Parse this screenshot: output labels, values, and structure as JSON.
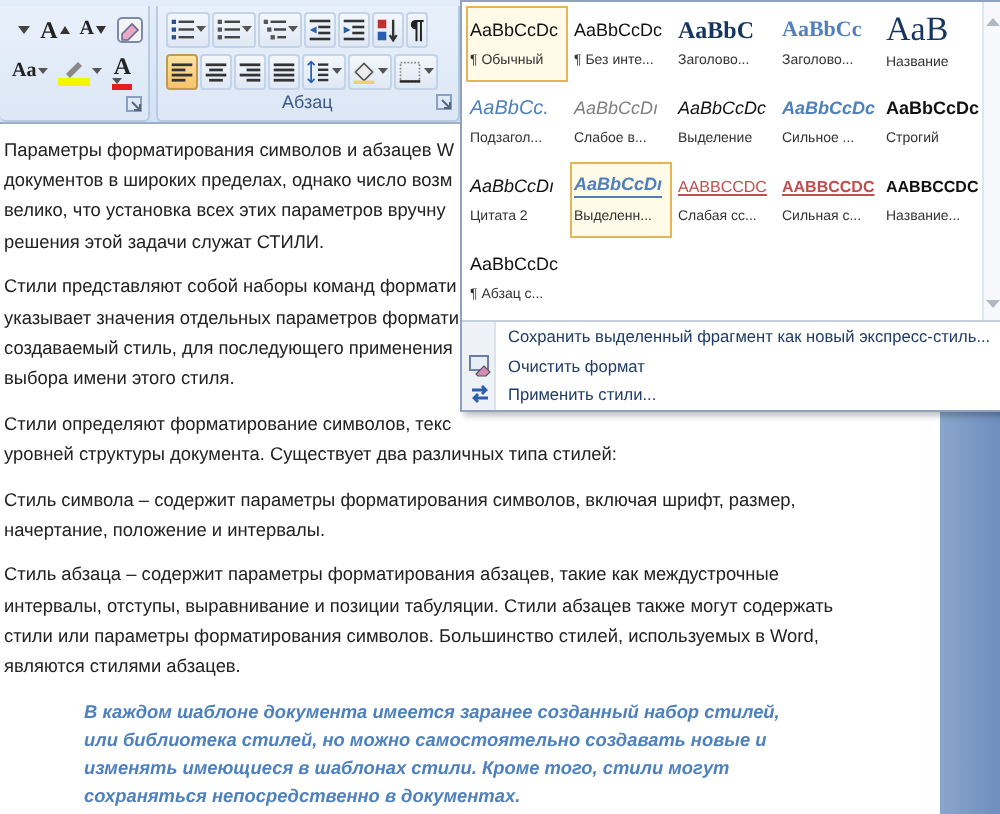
{
  "ribbon": {
    "font_group": {
      "rows": [
        [
          {
            "kind": "size-dropdown"
          },
          {
            "kind": "grow-font",
            "glyph": "A"
          },
          {
            "kind": "shrink-font",
            "glyph": "A"
          },
          {
            "kind": "clear-format"
          }
        ],
        [
          {
            "kind": "change-case",
            "glyph": "Aa"
          },
          {
            "kind": "highlight"
          },
          {
            "kind": "font-color",
            "glyph": "A"
          }
        ]
      ]
    },
    "paragraph_group": {
      "label": "Абзац",
      "rows": [
        [
          {
            "kind": "bullets",
            "dropdown": true,
            "selected": false
          },
          {
            "kind": "numbering",
            "dropdown": true,
            "selected": false
          },
          {
            "kind": "multilevel",
            "dropdown": true,
            "selected": false
          },
          {
            "kind": "decrease-indent",
            "dropdown": false,
            "selected": false
          },
          {
            "kind": "increase-indent",
            "dropdown": false,
            "selected": false
          },
          {
            "kind": "sort",
            "dropdown": false,
            "selected": false
          },
          {
            "kind": "pilcrow",
            "glyph": "¶",
            "dropdown": false,
            "selected": false
          }
        ],
        [
          {
            "kind": "align-left",
            "dropdown": false,
            "selected": true
          },
          {
            "kind": "align-center",
            "dropdown": false,
            "selected": false
          },
          {
            "kind": "align-right",
            "dropdown": false,
            "selected": false
          },
          {
            "kind": "justify",
            "dropdown": false,
            "selected": false
          },
          {
            "kind": "line-spacing",
            "dropdown": true,
            "selected": false
          },
          {
            "kind": "shading",
            "dropdown": true,
            "selected": false
          },
          {
            "kind": "borders",
            "dropdown": true,
            "selected": false
          }
        ]
      ]
    }
  },
  "document": {
    "paragraphs": [
      {
        "lines": [
          "Параметры форматирования символов и абзацев W",
          "документов в широких пределах, однако число возм",
          "велико, что установка всех этих параметров вручну",
          "решения этой задачи служат СТИЛИ."
        ]
      },
      {
        "lines": [
          "Стили представляют собой наборы команд формати",
          "указывает значения отдельных параметров формати",
          "создаваемый стиль, для последующего применения",
          "выбора имени этого стиля."
        ]
      },
      {
        "lines": [
          "Стили определяют форматирование символов, текс",
          "уровней структуры документа. Существует два различных типа стилей:"
        ]
      },
      {
        "lines": [
          "Стиль символа – содержит параметры форматирования символов, включая шрифт, размер,",
          "начертание, положение и интервалы."
        ]
      },
      {
        "lines": [
          "Стиль абзаца – содержит параметры форматирования абзацев, такие как междустрочные",
          "интервалы, отступы, выравнивание и позиции табуляции. Стили абзацев также могут содержать",
          "стили или параметры форматирования символов. Большинство стилей, используемых в Word,",
          "являются стилями абзацев."
        ]
      }
    ],
    "quote": {
      "lines": [
        "В каждом шаблоне документа имеется заранее созданный набор стилей,",
        "или библиотека стилей, но можно самостоятельно создавать новые и",
        "изменять имеющиеся в шаблонах стили. Кроме того, стили могут",
        "сохраняться непосредственно в документах."
      ]
    }
  },
  "styles_gallery": {
    "items": [
      {
        "preview": "AaBbCcDc",
        "name": "¶ Обычный",
        "kind": "normal",
        "selected": true
      },
      {
        "preview": "AaBbCcDc",
        "name": "¶ Без инте...",
        "kind": "normal",
        "selected": false
      },
      {
        "preview": "AaBbC",
        "name": "Заголово...",
        "kind": "heading1",
        "selected": false
      },
      {
        "preview": "AaBbCc",
        "name": "Заголово...",
        "kind": "heading2",
        "selected": false
      },
      {
        "preview": "AaB",
        "name": "Название",
        "kind": "title",
        "selected": false
      },
      {
        "preview": "AaBbCc.",
        "name": "Подзагол...",
        "kind": "subtitle",
        "selected": false
      },
      {
        "preview": "AaBbCcDı",
        "name": "Слабое в...",
        "kind": "subtle",
        "selected": false
      },
      {
        "preview": "AaBbCcDc",
        "name": "Выделение",
        "kind": "emphasis",
        "selected": false
      },
      {
        "preview": "AaBbCcDc",
        "name": "Сильное ...",
        "kind": "intense",
        "selected": false
      },
      {
        "preview": "AaBbCcDc",
        "name": "Строгий",
        "kind": "strong",
        "selected": false
      },
      {
        "preview": "AaBbCcDı",
        "name": "Цитата 2",
        "kind": "quote",
        "selected": false
      },
      {
        "preview": "AaBbCcDı",
        "name": "Выделенн...",
        "kind": "intensequote",
        "selected": true
      },
      {
        "preview": "AABBCCDC",
        "name": "Слабая сс...",
        "kind": "subtleref",
        "selected": false
      },
      {
        "preview": "AABBCCDC",
        "name": "Сильная с...",
        "kind": "intenseref",
        "selected": false
      },
      {
        "preview": "AABBCCDC",
        "name": "Название...",
        "kind": "booktitle",
        "selected": false
      },
      {
        "preview": "AaBbCcDc",
        "name": "¶ Абзац с...",
        "kind": "normal",
        "selected": false
      }
    ],
    "menu": [
      {
        "label": "Сохранить выделенный фрагмент как новый экспресс-стиль...",
        "kind": "save"
      },
      {
        "label": "Очистить формат",
        "kind": "clear"
      },
      {
        "label": "Применить стили...",
        "kind": "apply"
      }
    ]
  }
}
